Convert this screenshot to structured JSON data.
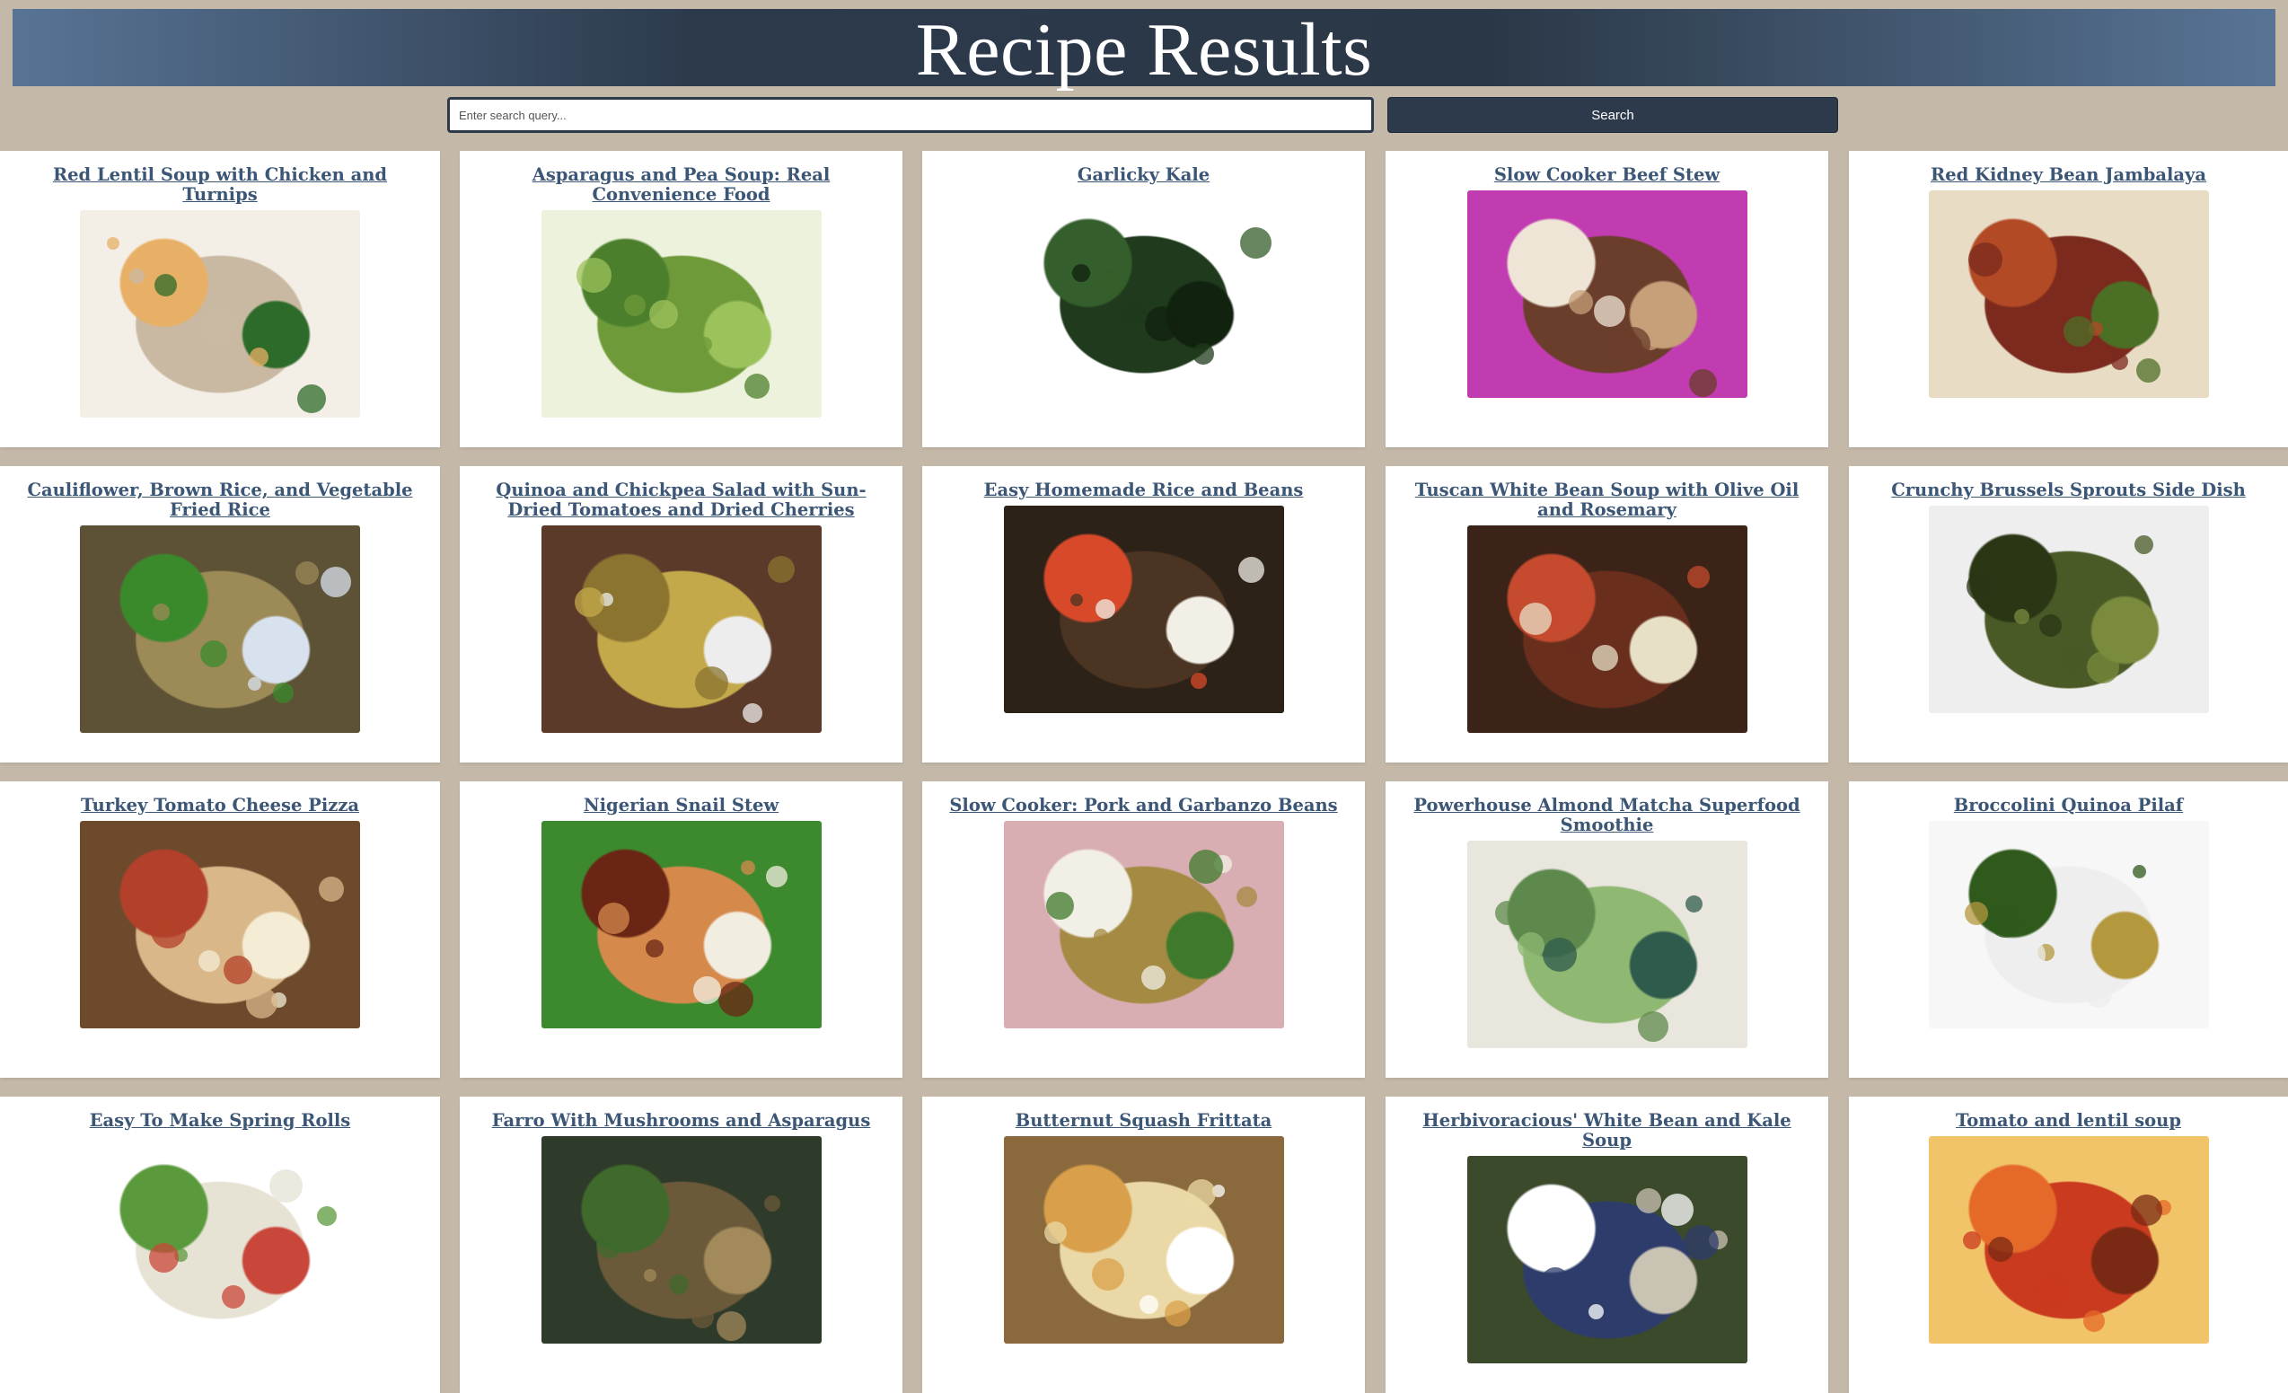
{
  "header": {
    "title": "Recipe Results"
  },
  "search": {
    "placeholder": "Enter search query...",
    "value": "",
    "button_label": "Search"
  },
  "recipes": [
    {
      "title": "Red Lentil Soup with Chicken and Turnips",
      "colors": [
        "#c9b9a3",
        "#e8b066",
        "#2d6b2a",
        "#f3efe6"
      ]
    },
    {
      "title": "Asparagus and Pea Soup: Real Convenience Food",
      "colors": [
        "#6f9a3a",
        "#4c7f2c",
        "#9cc25b",
        "#edf2dc"
      ]
    },
    {
      "title": "Garlicky Kale",
      "colors": [
        "#1f3a1c",
        "#345e2b",
        "#11220f",
        "#ffffff"
      ]
    },
    {
      "title": "Slow Cooker Beef Stew",
      "colors": [
        "#6b3e2b",
        "#efe5d7",
        "#c7a07a",
        "#c13bb1"
      ]
    },
    {
      "title": "Red Kidney Bean Jambalaya",
      "colors": [
        "#7b2a1d",
        "#b24a25",
        "#4c6f26",
        "#e9dcc5"
      ]
    },
    {
      "title": "Cauliflower, Brown Rice, and Vegetable Fried Rice",
      "colors": [
        "#9c8a57",
        "#3a8a2c",
        "#d8e2ee",
        "#5e5236"
      ]
    },
    {
      "title": "Quinoa and Chickpea Salad with Sun-Dried Tomatoes and Dried Cherries",
      "colors": [
        "#c4a94a",
        "#8a7430",
        "#ededed",
        "#5b3a2a"
      ]
    },
    {
      "title": "Easy Homemade Rice and Beans",
      "colors": [
        "#4b3422",
        "#d8492a",
        "#f2efe6",
        "#2d2218"
      ]
    },
    {
      "title": "Tuscan White Bean Soup with Olive Oil and Rosemary",
      "colors": [
        "#6a2e1d",
        "#c64a2e",
        "#e7e0c7",
        "#3b2417"
      ]
    },
    {
      "title": "Crunchy Brussels Sprouts Side Dish",
      "colors": [
        "#4a5a26",
        "#2a3614",
        "#7a8b3e",
        "#eeeeee"
      ]
    },
    {
      "title": "Turkey Tomato Cheese Pizza",
      "colors": [
        "#d9b789",
        "#b3402a",
        "#f4ecd5",
        "#6e4a2c"
      ]
    },
    {
      "title": "Nigerian Snail Stew",
      "colors": [
        "#d58a4c",
        "#6a2514",
        "#f2ede1",
        "#3c8a2d"
      ]
    },
    {
      "title": "Slow Cooker: Pork and Garbanzo Beans",
      "colors": [
        "#a48a42",
        "#f2efe6",
        "#3f7a2c",
        "#d9aeb2"
      ]
    },
    {
      "title": "Powerhouse Almond Matcha Superfood Smoothie",
      "colors": [
        "#8fb873",
        "#5d8a4c",
        "#2f5b4c",
        "#e9e6de"
      ]
    },
    {
      "title": "Broccolini Quinoa Pilaf",
      "colors": [
        "#eeeeee",
        "#2f5a1c",
        "#b3983d",
        "#f7f7f7"
      ]
    },
    {
      "title": "Easy To Make Spring Rolls",
      "colors": [
        "#e6e2d4",
        "#5a9a3c",
        "#c9473a",
        "#ffffff"
      ]
    },
    {
      "title": "Farro With Mushrooms and Asparagus",
      "colors": [
        "#6b5a3a",
        "#3f6a2c",
        "#a38a5b",
        "#2f3b2a"
      ]
    },
    {
      "title": "Butternut Squash Frittata",
      "colors": [
        "#ead9a6",
        "#d99f4a",
        "#ffffff",
        "#8a6a3c"
      ]
    },
    {
      "title": "Herbivoracious' White Bean and Kale Soup",
      "colors": [
        "#2d3c6b",
        "#ffffff",
        "#c9c3b3",
        "#3c4a2c"
      ]
    },
    {
      "title": "Tomato and lentil soup",
      "colors": [
        "#c93a1e",
        "#e56a2a",
        "#7a2a14",
        "#f2c46a"
      ]
    }
  ]
}
